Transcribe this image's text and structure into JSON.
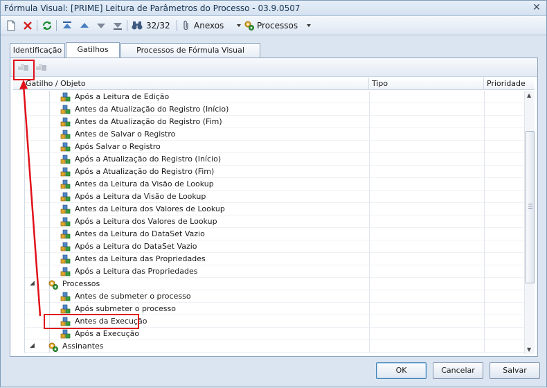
{
  "window": {
    "title": "Fórmula Visual: [PRIME] Leitura de Parâmetros do Processo - 03.9.0507",
    "close_glyph": "✕"
  },
  "toolbar": {
    "record_counter": "32/32",
    "attachments_label": "Anexos",
    "processes_label": "Processos"
  },
  "tabs": [
    {
      "label": "Identificação"
    },
    {
      "label": "Gatilhos"
    },
    {
      "label": "Processos de Fórmula Visual"
    }
  ],
  "grid": {
    "columns": [
      "Gatilho / Objeto",
      "Tipo",
      "Prioridade"
    ],
    "rows": [
      {
        "label": "Após a Leitura de Edição",
        "level": 2
      },
      {
        "label": "Antes da Atualização do Registro (Início)",
        "level": 2
      },
      {
        "label": "Antes da Atualização do Registro (Fim)",
        "level": 2
      },
      {
        "label": "Antes de Salvar o Registro",
        "level": 2
      },
      {
        "label": "Após Salvar o Registro",
        "level": 2
      },
      {
        "label": "Após a Atualização do Registro (Início)",
        "level": 2
      },
      {
        "label": "Após a Atualização do Registro (Fim)",
        "level": 2
      },
      {
        "label": "Antes da Leitura da Visão de Lookup",
        "level": 2
      },
      {
        "label": "Após a Leitura da Visão de Lookup",
        "level": 2
      },
      {
        "label": "Antes da Leitura dos Valores de Lookup",
        "level": 2
      },
      {
        "label": "Após a Leitura dos Valores de Lookup",
        "level": 2
      },
      {
        "label": "Antes da Leitura do DataSet Vazio",
        "level": 2
      },
      {
        "label": "Após a Leitura do DataSet Vazio",
        "level": 2
      },
      {
        "label": "Antes da Leitura das Propriedades",
        "level": 2
      },
      {
        "label": "Após a Leitura das Propriedades",
        "level": 2
      },
      {
        "label": "Processos",
        "level": 1
      },
      {
        "label": "Antes de submeter o processo",
        "level": 2
      },
      {
        "label": "Após submeter o processo",
        "level": 2
      },
      {
        "label": "Antes da Execução",
        "level": 2,
        "highlighted": true
      },
      {
        "label": "Após a Execução",
        "level": 2
      },
      {
        "label": "Assinantes",
        "level": 1
      }
    ]
  },
  "buttons": {
    "ok": "OK",
    "cancel": "Cancelar",
    "save": "Salvar"
  },
  "colors": {
    "annotation": "#e0101a",
    "accent": "#3c7fb1"
  }
}
